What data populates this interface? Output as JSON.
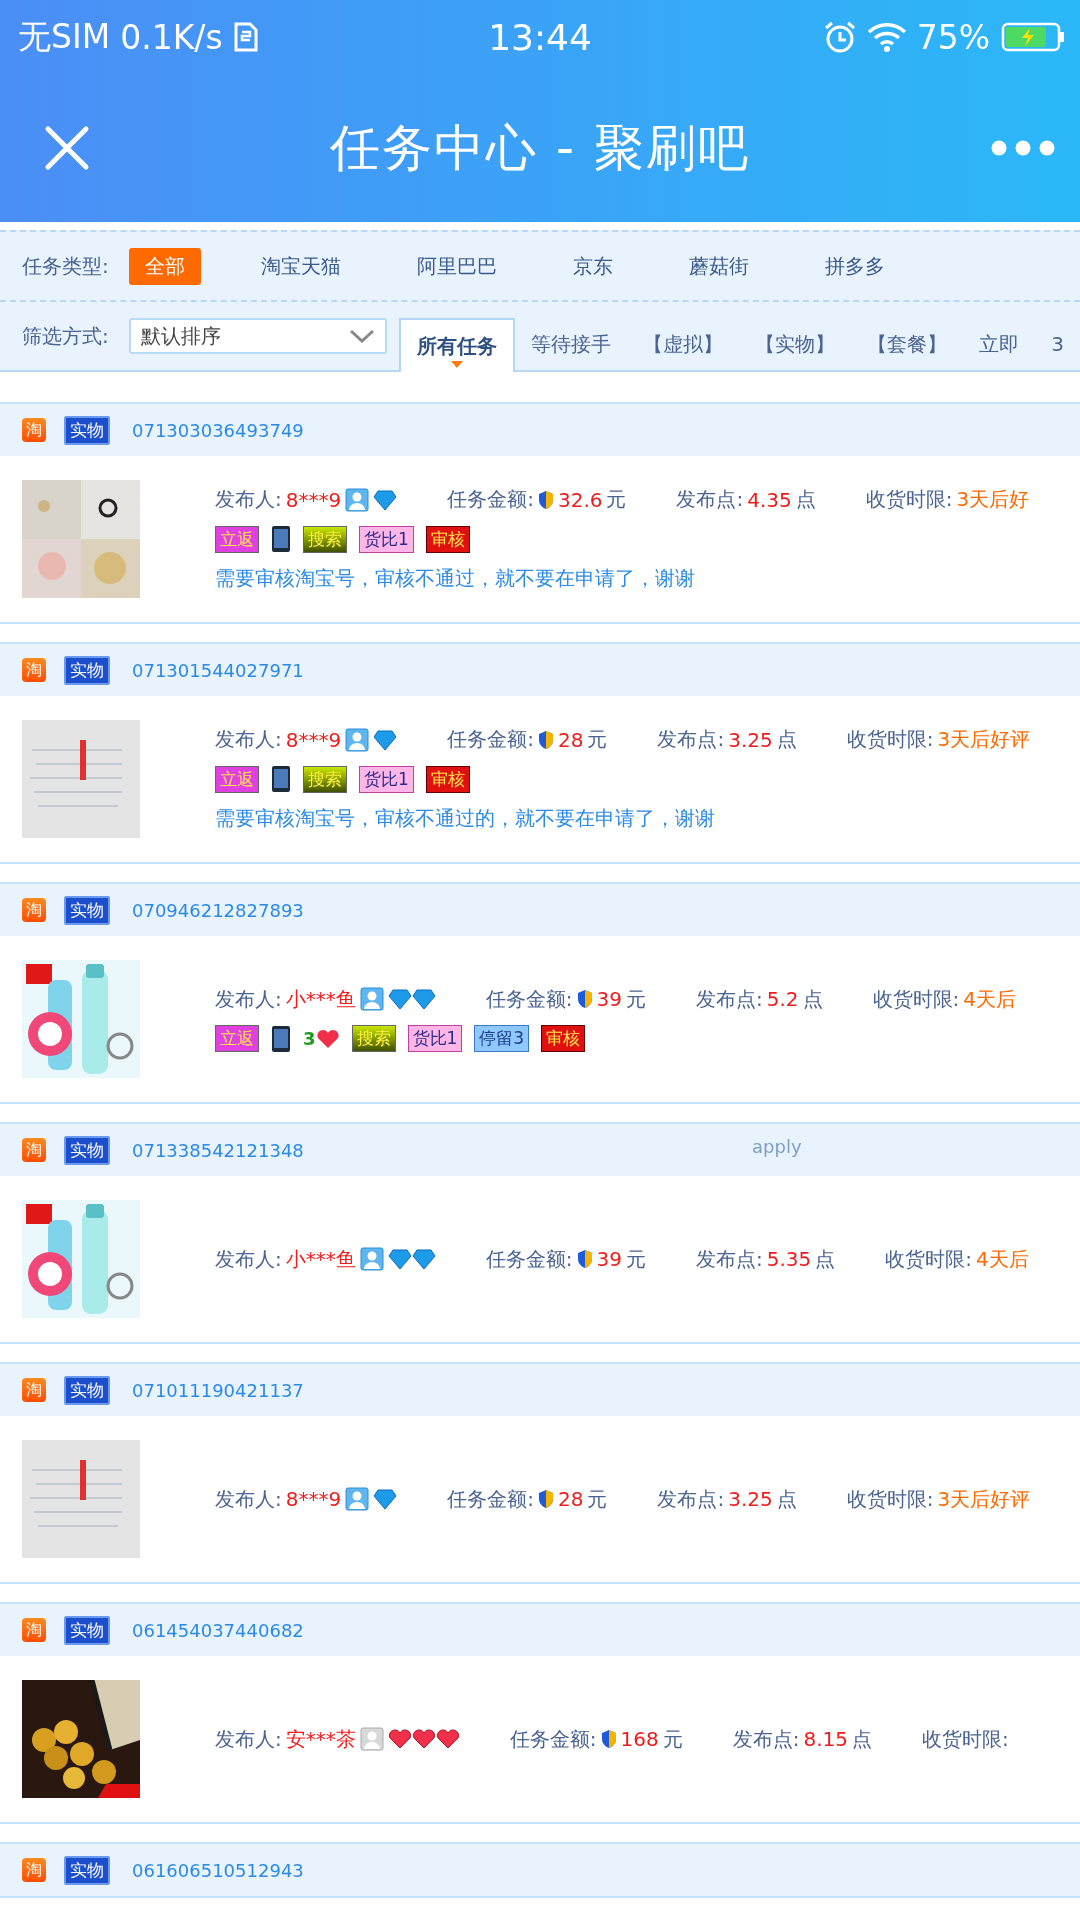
{
  "status_bar": {
    "carrier": "无SIM",
    "speed": "0.1K/s",
    "time": "13:44",
    "battery": "75%",
    "charging": true
  },
  "header": {
    "title": "任务中心 - 聚刷吧"
  },
  "type_filter": {
    "label": "任务类型:",
    "items": [
      {
        "label": "全部",
        "selected": true
      },
      {
        "label": "淘宝天猫",
        "selected": false
      },
      {
        "label": "阿里巴巴",
        "selected": false
      },
      {
        "label": "京东",
        "selected": false
      },
      {
        "label": "蘑菇街",
        "selected": false
      },
      {
        "label": "拼多多",
        "selected": false
      }
    ]
  },
  "sort_filter": {
    "label": "筛选方式:",
    "dropdown": "默认排序",
    "tabs": [
      {
        "label": "所有任务",
        "selected": true
      },
      {
        "label": "等待接手",
        "selected": false
      },
      {
        "label": "【虚拟】",
        "selected": false
      },
      {
        "label": "【实物】",
        "selected": false
      },
      {
        "label": "【套餐】",
        "selected": false
      },
      {
        "label": "立即",
        "selected": false
      },
      {
        "label": "3",
        "selected": false
      }
    ]
  },
  "tasks": [
    {
      "platform": "淘",
      "type": "实物",
      "id": "071303036493749",
      "picture": {
        "kind": "picture"
      },
      "publisher_label": "发布人:",
      "publisher": "8***9",
      "verified": true,
      "rank": [
        {
          "kind": "diamond"
        }
      ],
      "amount_label": "任务金额:",
      "amount": "32.6",
      "amount_unit": "元",
      "points_label": "发布点:",
      "points": "4.35",
      "points_unit": "点",
      "deadline_label": "收货时限:",
      "deadline": "3天后好",
      "tags": [
        {
          "kind": "fanli",
          "text": "立返"
        },
        {
          "kind": "device"
        },
        {
          "kind": "search",
          "text": "搜索"
        },
        {
          "kind": "compare",
          "text": "货比1"
        },
        {
          "kind": "review",
          "text": "审核"
        }
      ],
      "note": "需要审核淘宝号，审核不通过，就不要在申请了，谢谢"
    },
    {
      "platform": "淘",
      "type": "实物",
      "id": "071301544027971",
      "picture": {
        "kind": "picture"
      },
      "publisher_label": "发布人:",
      "publisher": "8***9",
      "verified": true,
      "rank": [
        {
          "kind": "diamond"
        }
      ],
      "amount_label": "任务金额:",
      "amount": "28",
      "amount_unit": "元",
      "points_label": "发布点:",
      "points": "3.25",
      "points_unit": "点",
      "deadline_label": "收货时限:",
      "deadline": "3天后好评",
      "tags": [
        {
          "kind": "fanli",
          "text": "立返"
        },
        {
          "kind": "device"
        },
        {
          "kind": "search",
          "text": "搜索"
        },
        {
          "kind": "compare",
          "text": "货比1"
        },
        {
          "kind": "review",
          "text": "审核"
        }
      ],
      "note": "需要审核淘宝号，审核不通过的，就不要在申请了，谢谢"
    },
    {
      "platform": "淘",
      "type": "实物",
      "id": "070946212827893",
      "picture": {
        "kind": "picture"
      },
      "publisher_label": "发布人:",
      "publisher": "小***鱼",
      "verified": true,
      "rank": [
        {
          "kind": "diamond"
        },
        {
          "kind": "diamond"
        }
      ],
      "amount_label": "任务金额:",
      "amount": "39",
      "amount_unit": "元",
      "points_label": "发布点:",
      "points": "5.2",
      "points_unit": "点",
      "deadline_label": "收货时限:",
      "deadline": "4天后",
      "tags": [
        {
          "kind": "fanli",
          "text": "立返"
        },
        {
          "kind": "device"
        },
        {
          "kind": "hearts",
          "text": "3"
        },
        {
          "kind": "search",
          "text": "搜索"
        },
        {
          "kind": "compare",
          "text": "货比1"
        },
        {
          "kind": "stay",
          "text": "停留3"
        },
        {
          "kind": "review",
          "text": "审核"
        }
      ]
    },
    {
      "platform": "淘",
      "type": "实物",
      "id": "071338542121348",
      "overlay": "apply",
      "picture": {
        "kind": "picture"
      },
      "publisher_label": "发布人:",
      "publisher": "小***鱼",
      "verified": true,
      "rank": [
        {
          "kind": "diamond"
        },
        {
          "kind": "diamond"
        }
      ],
      "amount_label": "任务金额:",
      "amount": "39",
      "amount_unit": "元",
      "points_label": "发布点:",
      "points": "5.35",
      "points_unit": "点",
      "deadline_label": "收货时限:",
      "deadline": "4天后"
    },
    {
      "platform": "淘",
      "type": "实物",
      "id": "071011190421137",
      "picture": {
        "kind": "picture"
      },
      "publisher_label": "发布人:",
      "publisher": "8***9",
      "verified": true,
      "rank": [
        {
          "kind": "diamond"
        }
      ],
      "amount_label": "任务金额:",
      "amount": "28",
      "amount_unit": "元",
      "points_label": "发布点:",
      "points": "3.25",
      "points_unit": "点",
      "deadline_label": "收货时限:",
      "deadline": "3天后好评"
    },
    {
      "platform": "淘",
      "type": "实物",
      "id": "061454037440682",
      "picture": {
        "kind": "picture"
      },
      "publisher_label": "发布人:",
      "publisher": "安***茶",
      "verified": false,
      "rank": [
        {
          "kind": "heart"
        },
        {
          "kind": "heart"
        },
        {
          "kind": "heart"
        }
      ],
      "amount_label": "任务金额:",
      "amount": "168",
      "amount_unit": "元",
      "points_label": "发布点:",
      "points": "8.15",
      "points_unit": "点",
      "deadline_label": "收货时限:"
    },
    {
      "platform": "淘",
      "type": "实物",
      "id": "061606510512943"
    }
  ]
}
